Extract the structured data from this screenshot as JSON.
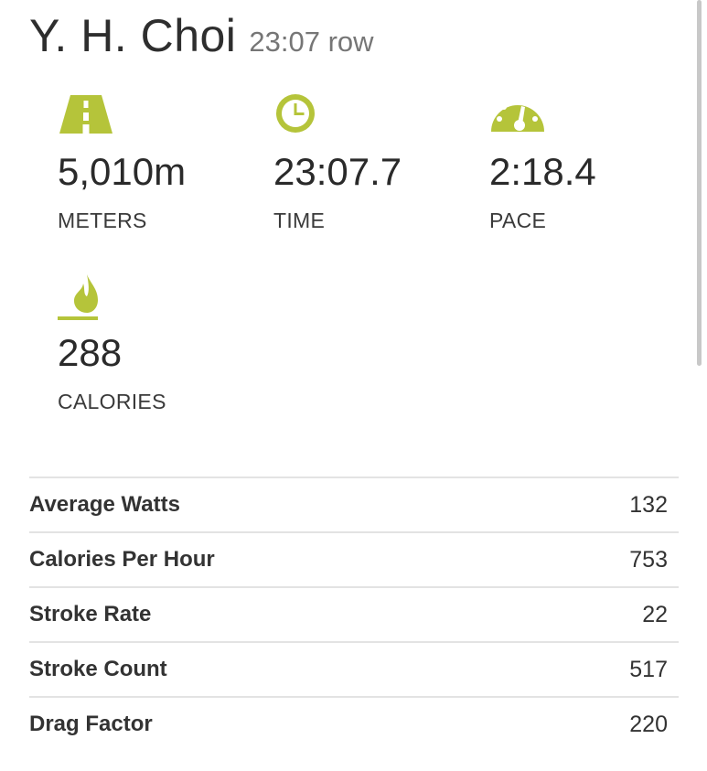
{
  "header": {
    "athlete": "Y. H. Choi",
    "summary": "23:07 row"
  },
  "stats": {
    "meters": {
      "value": "5,010m",
      "label": "METERS",
      "icon": "road-icon"
    },
    "time": {
      "value": "23:07.7",
      "label": "TIME",
      "icon": "clock-icon"
    },
    "pace": {
      "value": "2:18.4",
      "label": "PACE",
      "icon": "speedometer-icon"
    },
    "calories": {
      "value": "288",
      "label": "CALORIES",
      "icon": "flame-icon"
    }
  },
  "metrics": [
    {
      "name": "Average Watts",
      "value": "132"
    },
    {
      "name": "Calories Per Hour",
      "value": "753"
    },
    {
      "name": "Stroke Rate",
      "value": "22"
    },
    {
      "name": "Stroke Count",
      "value": "517"
    },
    {
      "name": "Drag Factor",
      "value": "220"
    }
  ],
  "colors": {
    "accent": "#b5c43a",
    "text": "#2b2b2b",
    "muted": "#767676",
    "divider": "#e3e3e3"
  }
}
